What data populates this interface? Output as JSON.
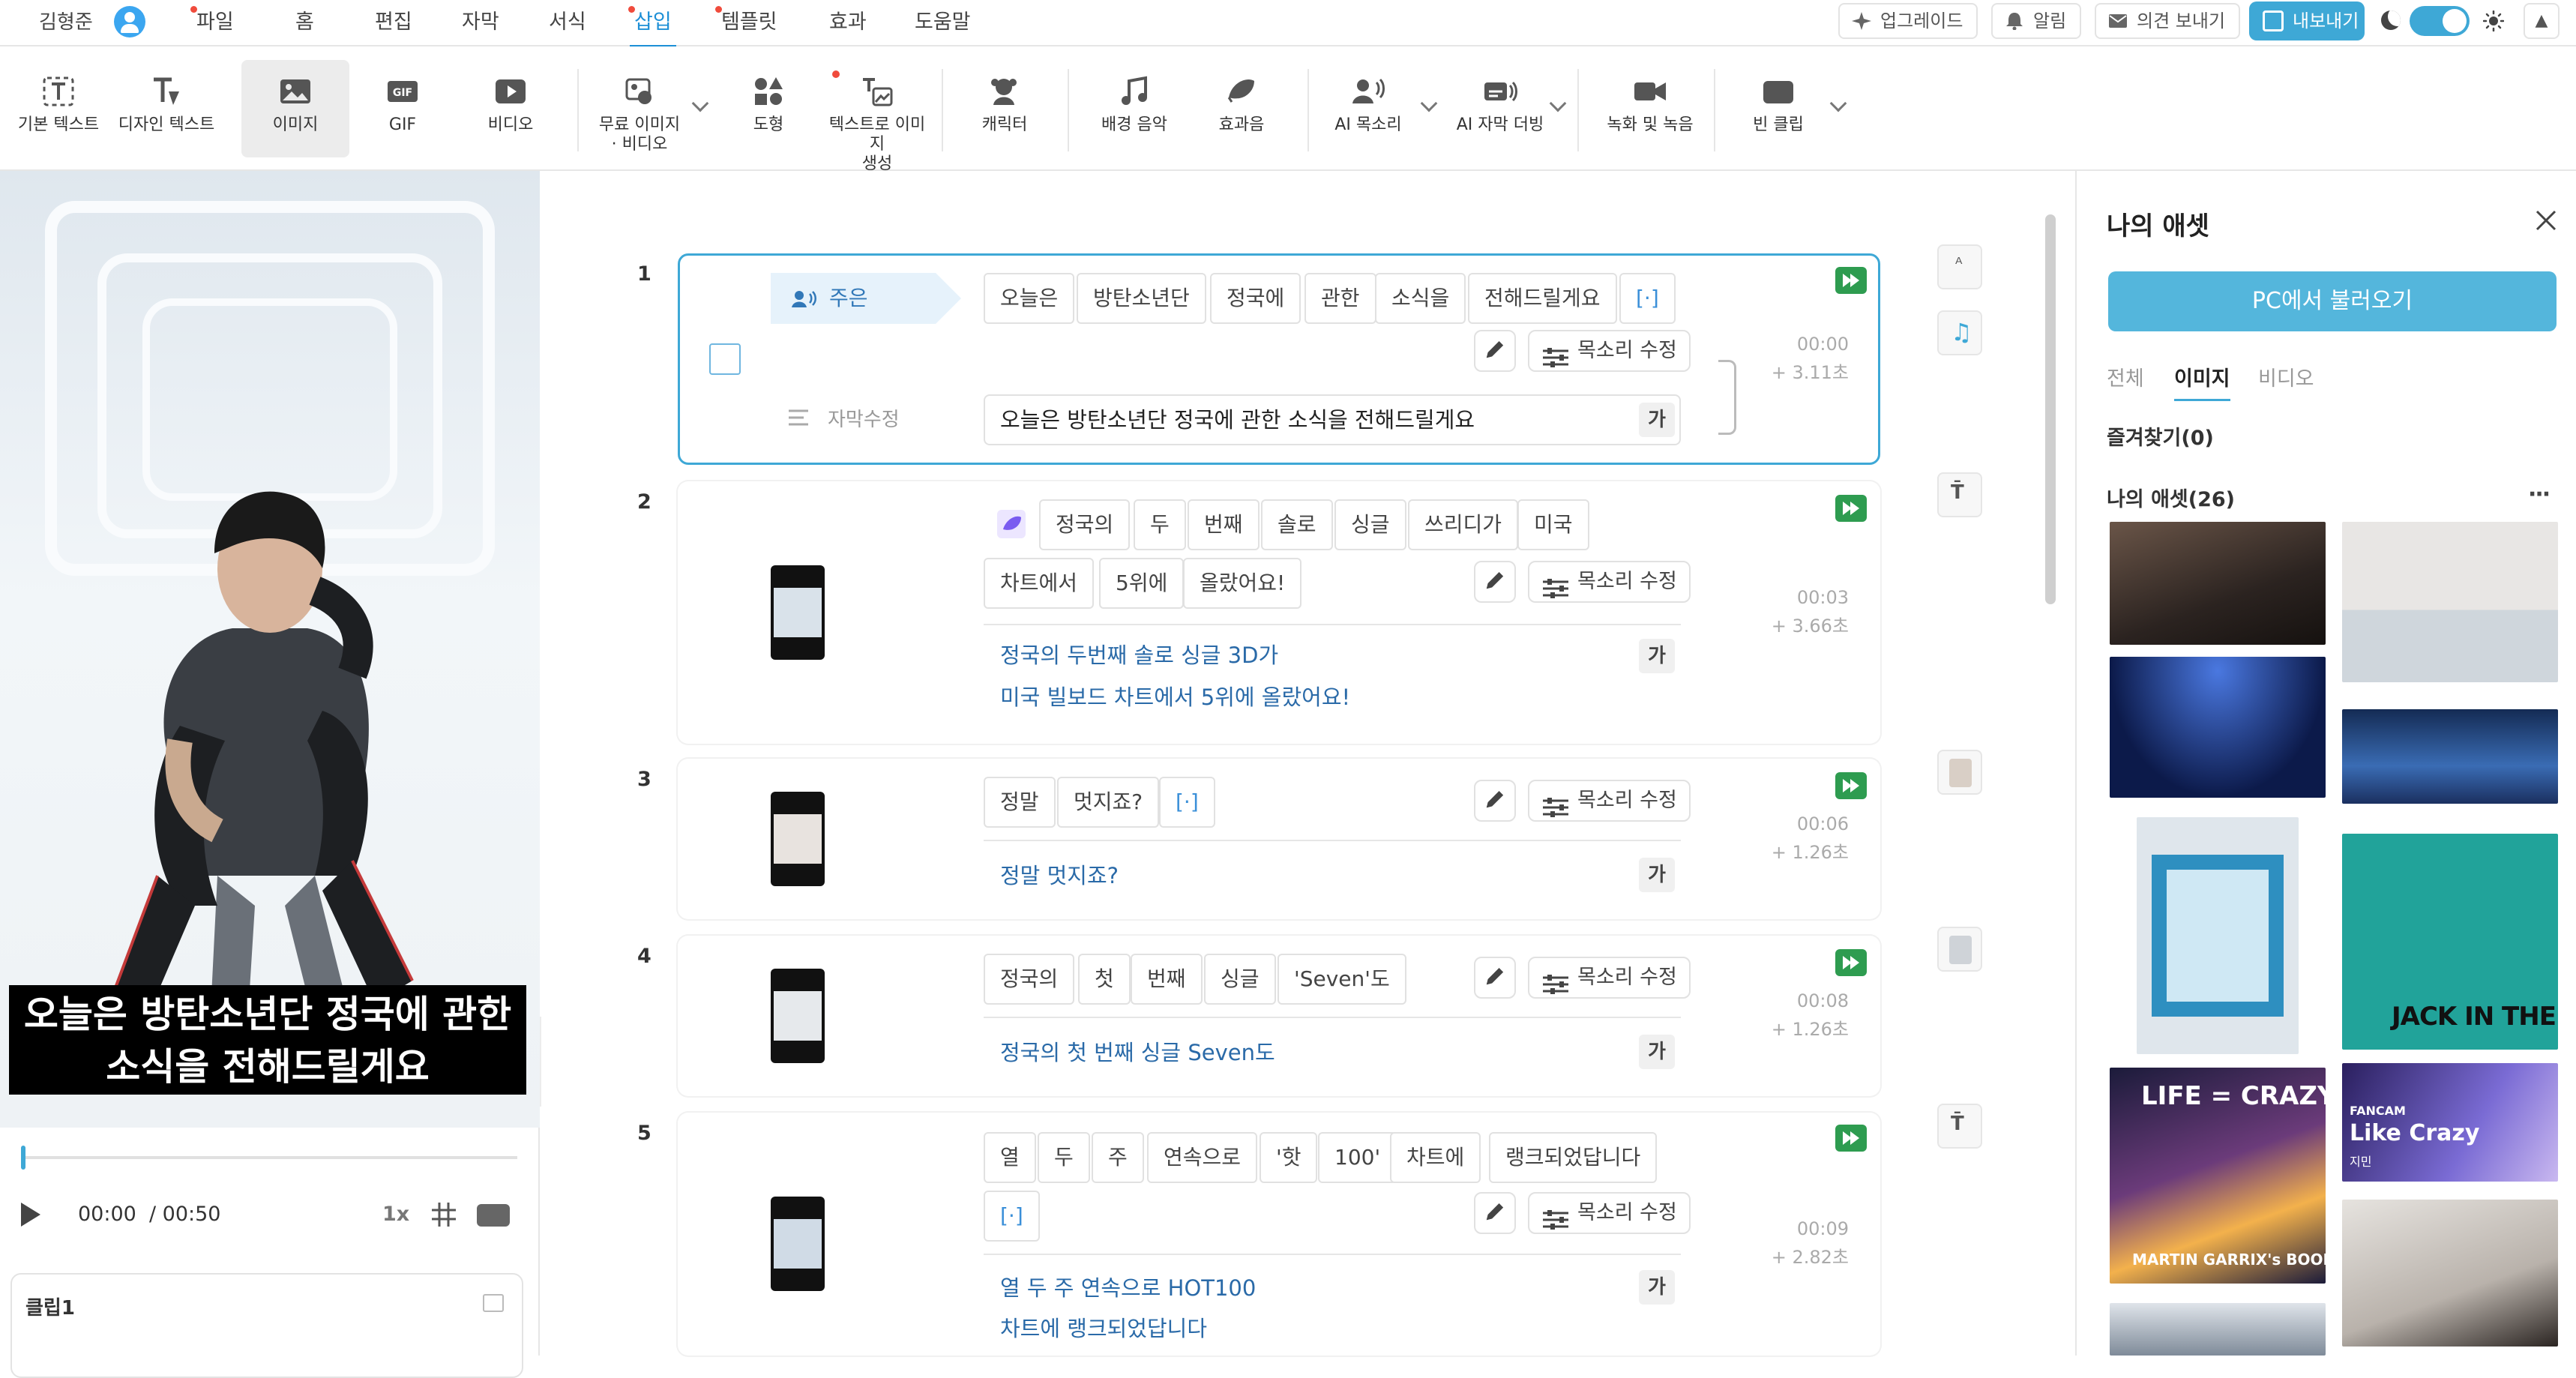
{
  "topbar": {
    "user": "김형준",
    "menus": [
      "파일",
      "홈",
      "편집",
      "자막",
      "서식",
      "삽입",
      "템플릿",
      "효과",
      "도움말"
    ],
    "upgrade": "업그레이드",
    "alarm": "알림",
    "feedback": "의견 보내기",
    "export": "내보내기"
  },
  "toolbar": {
    "items": [
      "기본 텍스트",
      "디자인 텍스트",
      "이미지",
      "GIF",
      "비디오",
      "무료 이미지\n· 비디오",
      "도형",
      "텍스트로 이미지\n생성",
      "캐릭터",
      "배경 음악",
      "효과음",
      "AI 목소리",
      "AI 자막 더빙",
      "녹화 및 녹음",
      "빈 클립"
    ],
    "selected": "이미지"
  },
  "preview": {
    "caption_line1": "오늘은 방탄소년단 정국에 관한",
    "caption_line2": "소식을 전해드릴게요",
    "time_current": "00:00",
    "time_total": "/ 00:50",
    "speed": "1x",
    "clip_label": "클립1",
    "playhead_fraction": 0.0
  },
  "scenes": [
    {
      "num": "1",
      "speaker": "주은",
      "words": [
        "오늘은",
        "방탄소년단",
        "정국에",
        "관한",
        "소식을",
        "전해드릴게요",
        "[·]"
      ],
      "voice_edit": "목소리 수정",
      "sub_edit_label": "자막수정",
      "subtitle": "오늘은 방탄소년단 정국에 관한 소식을 전해드릴게요",
      "ga": "가",
      "time": "00:00",
      "dur": "+ 3.11초"
    },
    {
      "num": "2",
      "words": [
        "정국의",
        "두",
        "번째",
        "솔로",
        "싱글",
        "쓰리디가",
        "미국",
        "차트에서",
        "5위에",
        "올랐어요!"
      ],
      "voice_edit": "목소리 수정",
      "subtitle_line1": "정국의 두번째 솔로 싱글 3D가",
      "subtitle_line2": "미국 빌보드 차트에서 5위에 올랐어요!",
      "ga": "가",
      "time": "00:03",
      "dur": "+ 3.66초"
    },
    {
      "num": "3",
      "words": [
        "정말",
        "멋지죠?",
        "[·]"
      ],
      "voice_edit": "목소리 수정",
      "subtitle": "정말 멋지죠?",
      "ga": "가",
      "time": "00:06",
      "dur": "+ 1.26초"
    },
    {
      "num": "4",
      "words": [
        "정국의",
        "첫",
        "번째",
        "싱글",
        "'Seven'도"
      ],
      "voice_edit": "목소리 수정",
      "subtitle": "정국의 첫 번째 싱글 Seven도",
      "ga": "가",
      "time": "00:08",
      "dur": "+ 1.26초"
    },
    {
      "num": "5",
      "words": [
        "열",
        "두",
        "주",
        "연속으로",
        "'핫",
        "100'",
        "차트에",
        "랭크되었답니다",
        "[·]"
      ],
      "voice_edit": "목소리 수정",
      "subtitle_line1": "열 두 주 연속으로 HOT100",
      "subtitle_line2": "차트에 랭크되었답니다",
      "ga": "가",
      "time": "00:09",
      "dur": "+ 2.82초"
    }
  ],
  "assets": {
    "title": "나의 애셋",
    "pc_button": "PC에서 불러오기",
    "tabs": [
      "전체",
      "이미지",
      "비디오"
    ],
    "active_tab": "이미지",
    "favorites": "즐겨찾기(0)",
    "mine": "나의 애셋(26)",
    "more": "···",
    "thumb_texts": {
      "life_crazy": "LIFE = CRAZY",
      "garrix": "MARTIN GARRIX's BOOK",
      "jack": "JACK IN THE BOX",
      "fancam": "FANCAM",
      "like_crazy": "Like Crazy",
      "jimin": "지민"
    }
  },
  "colors": {
    "accent": "#3ea8d6",
    "menu_active": "#1d8fd6",
    "subtitle_blue": "#2a6aa8",
    "play_green": "#2e9c50",
    "red_dot": "#f04b3c"
  }
}
